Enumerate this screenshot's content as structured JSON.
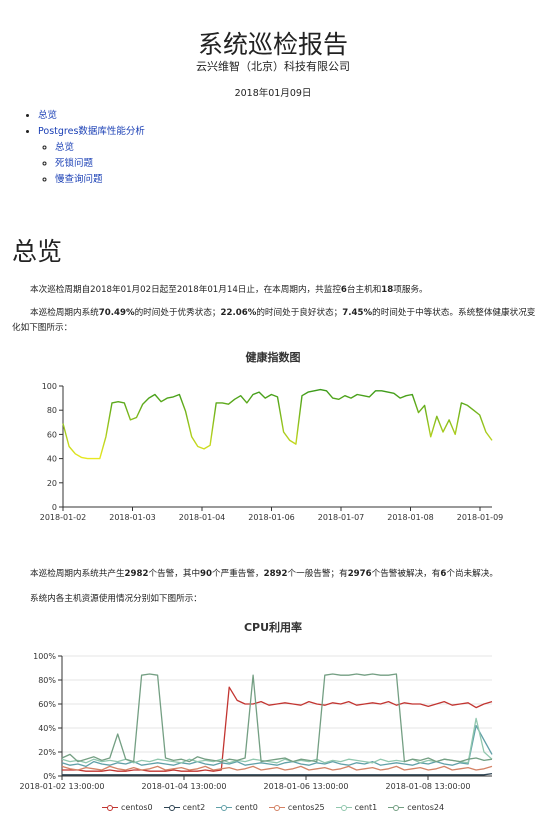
{
  "header": {
    "title": "系统巡检报告",
    "company": "云兴维智（北京）科技有限公司",
    "date": "2018年01月09日"
  },
  "toc": {
    "items": [
      "总览",
      "Postgres数据库性能分析"
    ],
    "sub_items": [
      "总览",
      "死锁问题",
      "慢查询问题"
    ]
  },
  "overview": {
    "heading": "总览",
    "p1": {
      "t1": "本次巡检周期自2018年01月02日起至2018年01月14日止，在本周期内，共监控",
      "b1": "6",
      "t2": "台主机和",
      "b2": "18",
      "t3": "项服务。"
    },
    "p2": {
      "t1": "本巡检周期内系统",
      "b1": "70.49%",
      "t2": "的时间处于优秀状态；",
      "b2": "22.06%",
      "t3": "的时间处于良好状态；",
      "b3": "7.45%",
      "t4": "的时间处于中等状态。系统整体健康状况变化如下图所示："
    },
    "p3": {
      "t1": "本巡检周期内系统共产生",
      "b1": "2982",
      "t2": "个告警，其中",
      "b2": "90",
      "t3": "个严重告警，",
      "b3": "2892",
      "t4": "个一般告警；有",
      "b4": "2976",
      "t5": "个告警被解决，有",
      "b5": "6",
      "t6": "个尚未解决。"
    },
    "p4": "系统内各主机资源使用情况分别如下图所示："
  },
  "colors": {
    "health_gradient": [
      "#e8e820",
      "#93c21e",
      "#3a9a1a"
    ],
    "cpu_series": [
      "#c23531",
      "#2f4554",
      "#61a0a8",
      "#d48265",
      "#91c7ae",
      "#749f83"
    ]
  },
  "chart_data": [
    {
      "type": "line",
      "title": "健康指数图",
      "ylim": [
        0,
        100
      ],
      "yticks": [
        "0",
        "20",
        "40",
        "60",
        "80",
        "100"
      ],
      "xticks": [
        "2018-01-02",
        "2018-01-03",
        "2018-01-04",
        "2018-01-06",
        "2018-01-07",
        "2018-01-08",
        "2018-01-09"
      ],
      "series": [
        {
          "values": [
            69,
            50,
            44,
            41,
            40,
            40,
            40,
            58,
            86,
            87,
            86,
            72,
            74,
            85,
            90,
            93,
            87,
            90,
            91,
            93,
            79,
            58,
            50,
            48,
            51,
            86,
            86,
            85,
            89,
            92,
            86,
            93,
            95,
            90,
            93,
            91,
            62,
            55,
            52,
            92,
            95,
            96,
            97,
            96,
            90,
            89,
            92,
            90,
            93,
            92,
            91,
            96,
            96,
            95,
            94,
            90,
            92,
            93,
            78,
            84,
            58,
            75,
            62,
            72,
            60,
            86,
            84,
            80,
            76,
            62,
            55
          ]
        }
      ]
    },
    {
      "type": "line",
      "title": "CPU利用率",
      "ylim": [
        0,
        100
      ],
      "yticks": [
        "0%",
        "20%",
        "40%",
        "60%",
        "80%",
        "100%"
      ],
      "xticks": [
        "2018-01-02 13:00:00",
        "2018-01-04 13:00:00",
        "2018-01-06 13:00:00",
        "2018-01-08 13:00:00"
      ],
      "series": [
        {
          "name": "centos0",
          "values": [
            5,
            5,
            5,
            4,
            4,
            4,
            5,
            4,
            4,
            5,
            5,
            4,
            4,
            4,
            5,
            4,
            4,
            4,
            5,
            4,
            5,
            74,
            63,
            60,
            60,
            62,
            59,
            60,
            61,
            60,
            59,
            62,
            60,
            59,
            61,
            60,
            62,
            59,
            60,
            61,
            60,
            62,
            59,
            61,
            60,
            60,
            58,
            60,
            62,
            59,
            60,
            61,
            57,
            60,
            62
          ]
        },
        {
          "name": "cent2",
          "values": [
            1,
            1,
            1,
            1,
            1,
            1,
            1,
            1,
            1,
            1,
            1,
            1,
            1,
            1,
            1,
            1,
            1,
            1,
            1,
            1,
            1,
            1,
            1,
            1,
            1,
            1,
            1,
            1,
            1,
            1,
            1,
            1,
            1,
            1,
            1,
            1,
            1,
            1,
            1,
            1,
            1,
            1,
            1,
            1,
            1,
            1,
            1,
            1,
            1,
            1,
            1,
            1,
            1,
            1,
            2
          ]
        },
        {
          "name": "cent0",
          "values": [
            11,
            9,
            10,
            8,
            12,
            10,
            9,
            11,
            10,
            12,
            9,
            10,
            11,
            10,
            9,
            11,
            10,
            12,
            10,
            9,
            11,
            10,
            12,
            9,
            10,
            11,
            10,
            9,
            11,
            12,
            10,
            9,
            11,
            10,
            12,
            10,
            9,
            11,
            10,
            12,
            9,
            10,
            11,
            10,
            9,
            11,
            10,
            12,
            10,
            9,
            11,
            10,
            42,
            30,
            18
          ]
        },
        {
          "name": "centos25",
          "values": [
            8,
            6,
            5,
            7,
            6,
            5,
            8,
            6,
            5,
            7,
            5,
            6,
            8,
            5,
            6,
            7,
            5,
            6,
            8,
            5,
            6,
            7,
            5,
            6,
            8,
            5,
            6,
            7,
            5,
            6,
            8,
            5,
            6,
            7,
            5,
            6,
            8,
            5,
            6,
            7,
            5,
            6,
            8,
            5,
            6,
            7,
            5,
            6,
            8,
            5,
            6,
            7,
            5,
            6,
            8
          ]
        },
        {
          "name": "cent1",
          "values": [
            14,
            12,
            13,
            11,
            14,
            12,
            13,
            12,
            14,
            11,
            13,
            12,
            14,
            13,
            12,
            11,
            14,
            12,
            13,
            12,
            14,
            11,
            13,
            12,
            14,
            13,
            12,
            11,
            14,
            12,
            13,
            12,
            14,
            11,
            13,
            12,
            14,
            13,
            12,
            11,
            14,
            12,
            13,
            12,
            14,
            11,
            13,
            12,
            14,
            13,
            12,
            11,
            48,
            20,
            14
          ]
        },
        {
          "name": "centos24",
          "values": [
            15,
            18,
            12,
            14,
            16,
            13,
            15,
            35,
            14,
            12,
            84,
            85,
            84,
            15,
            13,
            14,
            12,
            16,
            14,
            13,
            12,
            14,
            13,
            15,
            84,
            12,
            13,
            14,
            15,
            12,
            14,
            13,
            12,
            84,
            85,
            84,
            84,
            85,
            84,
            85,
            84,
            84,
            85,
            12,
            14,
            13,
            15,
            12,
            14,
            13,
            12,
            14,
            15,
            13,
            14
          ]
        }
      ]
    }
  ]
}
